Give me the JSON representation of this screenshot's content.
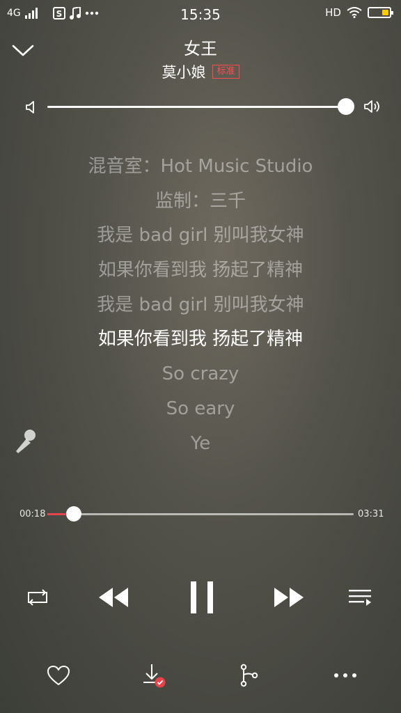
{
  "status_bar": {
    "network": "4G",
    "time": "15:35",
    "hd": "HD",
    "battery_level": 0.35,
    "battery_color": "#ffcc00"
  },
  "header": {
    "title": "女王",
    "artist": "莫小娘",
    "quality_badge": "标准",
    "collapse_icon": "chevron-down-icon"
  },
  "volume": {
    "level": 1.0,
    "low_icon": "speaker-low-icon",
    "high_icon": "speaker-high-icon"
  },
  "lyrics": {
    "lines": [
      "混音室：Hot Music Studio",
      "监制：三千",
      "我是 bad girl 别叫我女神",
      "如果你看到我 扬起了精神",
      "我是 bad girl 别叫我女神",
      "如果你看到我 扬起了精神",
      "So crazy",
      "So eary",
      "Ye"
    ],
    "active_index": 5
  },
  "playback": {
    "current_time": "00:18",
    "total_time": "03:31",
    "progress": 0.0853,
    "accent_color": "#e8434a"
  },
  "controls": {
    "repeat_icon": "repeat-icon",
    "prev_icon": "previous-icon",
    "pause_icon": "pause-icon",
    "next_icon": "next-icon",
    "playlist_icon": "playlist-icon"
  },
  "actions": {
    "like_icon": "heart-icon",
    "download_icon": "download-icon",
    "share_icon": "share-icon",
    "more_icon": "more-icon",
    "download_badge_color": "#e8434a"
  }
}
